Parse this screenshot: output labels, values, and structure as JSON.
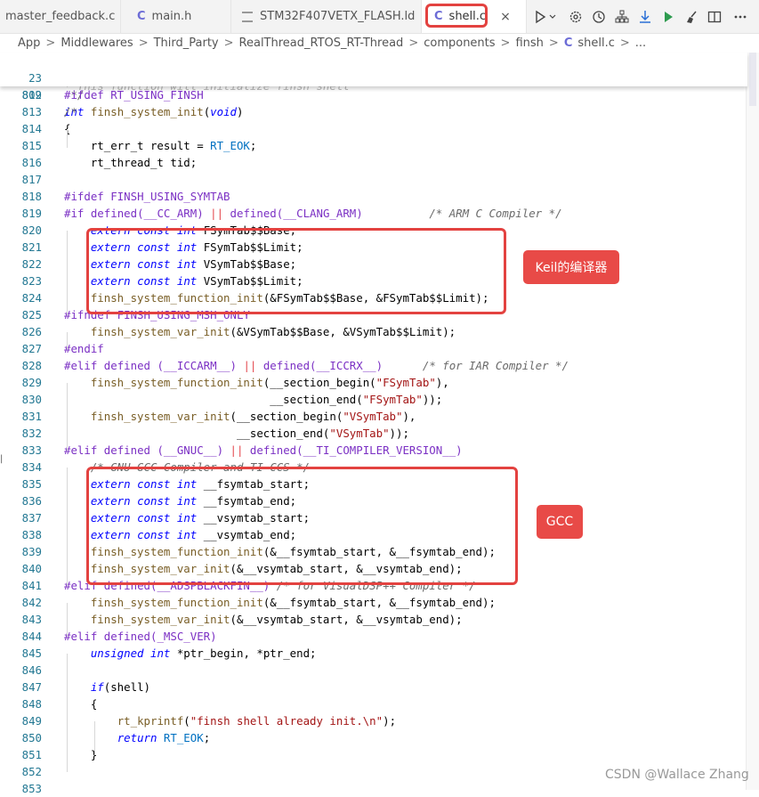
{
  "tabs": [
    {
      "label": "master_feedback.c",
      "icon": "c-file-icon",
      "active": false
    },
    {
      "label": "main.h",
      "icon": "c-file-icon",
      "active": false
    },
    {
      "label": "STM32F407VETX_FLASH.ld",
      "icon": "ld-file-icon",
      "active": false
    },
    {
      "label": "shell.c",
      "icon": "c-file-icon",
      "active": true
    }
  ],
  "tab_icon_glyph": "C",
  "close_glyph": "×",
  "breadcrumb": [
    "App",
    "Middlewares",
    "Third_Party",
    "RealThread_RTOS_RT-Thread",
    "components",
    "finsh",
    "shell.c",
    "..."
  ],
  "breadcrumb_sep": ">",
  "toolbar": [
    "run-debug-icon",
    "gear-icon",
    "history-icon",
    "hierarchy-icon",
    "download-icon",
    "play-icon",
    "broom-icon",
    "split-editor-icon",
    "more-icon"
  ],
  "annotations": {
    "keil_label": "Keil的编译器",
    "gcc_label": "GCC"
  },
  "watermark": "CSDN @Wallace Zhang",
  "code": {
    "sticky": [
      {
        "n": "23",
        "text": "#ifdef RT_USING_FINSH"
      },
      {
        "n": "809",
        "text": "/*"
      }
    ],
    "hidden_partial": "* This function will initialize finsh shell",
    "lines": [
      {
        "n": "812",
        "text": " */"
      },
      {
        "n": "813",
        "text": "int finsh_system_init(void)"
      },
      {
        "n": "814",
        "text": "{"
      },
      {
        "n": "815",
        "text": "    rt_err_t result = RT_EOK;"
      },
      {
        "n": "816",
        "text": "    rt_thread_t tid;"
      },
      {
        "n": "817",
        "text": ""
      },
      {
        "n": "818",
        "text": "#ifdef FINSH_USING_SYMTAB"
      },
      {
        "n": "819",
        "text": "#if defined(__CC_ARM) || defined(__CLANG_ARM)          /* ARM C Compiler */"
      },
      {
        "n": "820",
        "text": "    extern const int FSymTab$$Base;"
      },
      {
        "n": "821",
        "text": "    extern const int FSymTab$$Limit;"
      },
      {
        "n": "822",
        "text": "    extern const int VSymTab$$Base;"
      },
      {
        "n": "823",
        "text": "    extern const int VSymTab$$Limit;"
      },
      {
        "n": "824",
        "text": "    finsh_system_function_init(&FSymTab$$Base, &FSymTab$$Limit);"
      },
      {
        "n": "825",
        "text": "#ifndef FINSH_USING_MSH_ONLY"
      },
      {
        "n": "826",
        "text": "    finsh_system_var_init(&VSymTab$$Base, &VSymTab$$Limit);"
      },
      {
        "n": "827",
        "text": "#endif"
      },
      {
        "n": "828",
        "text": "#elif defined (__ICCARM__) || defined(__ICCRX__)      /* for IAR Compiler */"
      },
      {
        "n": "829",
        "text": "    finsh_system_function_init(__section_begin(\"FSymTab\"),"
      },
      {
        "n": "830",
        "text": "                               __section_end(\"FSymTab\"));"
      },
      {
        "n": "831",
        "text": "    finsh_system_var_init(__section_begin(\"VSymTab\"),"
      },
      {
        "n": "832",
        "text": "                          __section_end(\"VSymTab\"));"
      },
      {
        "n": "833",
        "text": "#elif defined (__GNUC__) || defined(__TI_COMPILER_VERSION__)"
      },
      {
        "n": "834",
        "text": "    /* GNU GCC Compiler and TI CCS */"
      },
      {
        "n": "835",
        "text": "    extern const int __fsymtab_start;"
      },
      {
        "n": "836",
        "text": "    extern const int __fsymtab_end;"
      },
      {
        "n": "837",
        "text": "    extern const int __vsymtab_start;"
      },
      {
        "n": "838",
        "text": "    extern const int __vsymtab_end;"
      },
      {
        "n": "839",
        "text": "    finsh_system_function_init(&__fsymtab_start, &__fsymtab_end);"
      },
      {
        "n": "840",
        "text": "    finsh_system_var_init(&__vsymtab_start, &__vsymtab_end);"
      },
      {
        "n": "841",
        "text": "#elif defined(__ADSPBLACKFIN__) /* for VisualDSP++ Compiler */"
      },
      {
        "n": "842",
        "text": "    finsh_system_function_init(&__fsymtab_start, &__fsymtab_end);"
      },
      {
        "n": "843",
        "text": "    finsh_system_var_init(&__vsymtab_start, &__vsymtab_end);"
      },
      {
        "n": "844",
        "text": "#elif defined(_MSC_VER)"
      },
      {
        "n": "845",
        "text": "    unsigned int *ptr_begin, *ptr_end;"
      },
      {
        "n": "846",
        "text": ""
      },
      {
        "n": "847",
        "text": "    if(shell)"
      },
      {
        "n": "848",
        "text": "    {"
      },
      {
        "n": "849",
        "text": "        rt_kprintf(\"finsh shell already init.\\n\");"
      },
      {
        "n": "850",
        "text": "        return RT_EOK;"
      },
      {
        "n": "851",
        "text": "    }"
      },
      {
        "n": "852",
        "text": ""
      },
      {
        "n": "853",
        "text": ""
      }
    ]
  },
  "colors": {
    "accent_box": "#e34240",
    "label_bg": "#e84a47",
    "line_number": "#237893",
    "preprocessor": "#7b30c4",
    "keyword": "#0000ff"
  }
}
